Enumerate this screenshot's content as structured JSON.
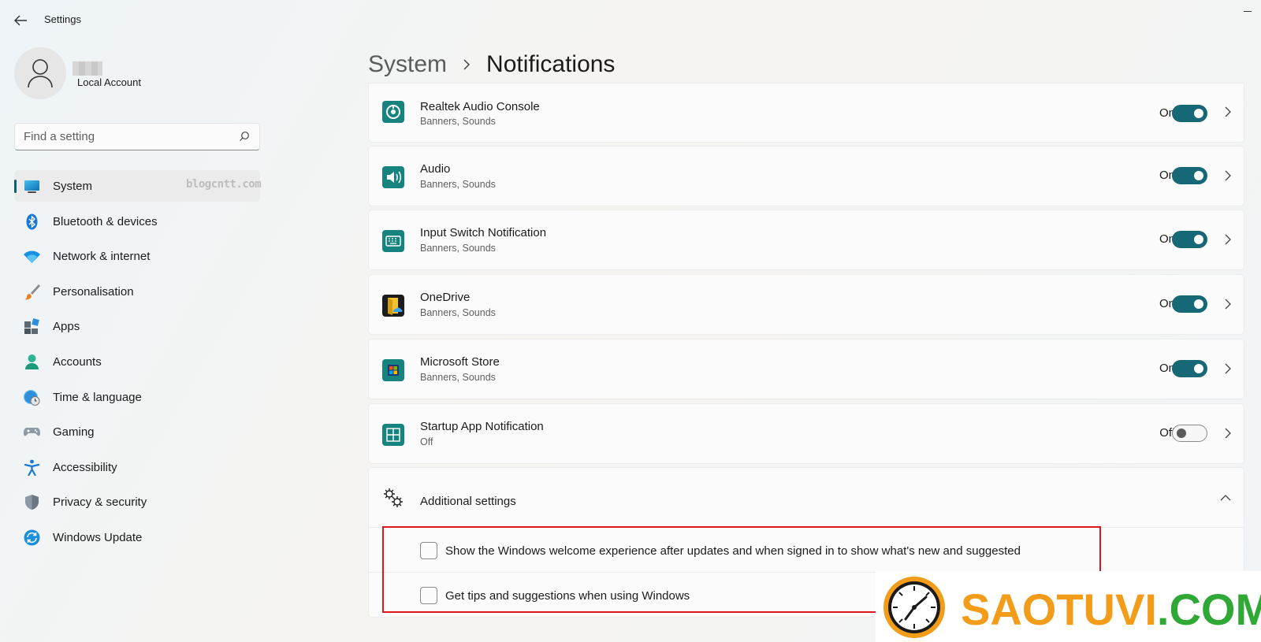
{
  "window": {
    "title": "Settings"
  },
  "profile": {
    "account_type": "Local Account"
  },
  "search": {
    "placeholder": "Find a setting"
  },
  "sidebar": {
    "watermark": "blogcntt.com",
    "items": [
      {
        "label": "System",
        "icon": "monitor-icon",
        "active": true
      },
      {
        "label": "Bluetooth & devices",
        "icon": "bluetooth-icon"
      },
      {
        "label": "Network & internet",
        "icon": "wifi-icon"
      },
      {
        "label": "Personalisation",
        "icon": "brush-icon"
      },
      {
        "label": "Apps",
        "icon": "apps-icon"
      },
      {
        "label": "Accounts",
        "icon": "person-icon"
      },
      {
        "label": "Time & language",
        "icon": "globe-clock-icon"
      },
      {
        "label": "Gaming",
        "icon": "gamepad-icon"
      },
      {
        "label": "Accessibility",
        "icon": "accessibility-icon"
      },
      {
        "label": "Privacy & security",
        "icon": "shield-icon"
      },
      {
        "label": "Windows Update",
        "icon": "sync-icon"
      }
    ]
  },
  "breadcrumb": {
    "parent": "System",
    "current": "Notifications"
  },
  "apps": [
    {
      "name": "Realtek Audio Console",
      "detail": "Banners, Sounds",
      "state": "On",
      "on": true,
      "icon": "realtek-icon"
    },
    {
      "name": "Audio",
      "detail": "Banners, Sounds",
      "state": "On",
      "on": true,
      "icon": "speaker-icon"
    },
    {
      "name": "Input Switch Notification",
      "detail": "Banners, Sounds",
      "state": "On",
      "on": true,
      "icon": "keyboard-icon"
    },
    {
      "name": "OneDrive",
      "detail": "Banners, Sounds",
      "state": "On",
      "on": true,
      "icon": "onedrive-icon"
    },
    {
      "name": "Microsoft Store",
      "detail": "Banners, Sounds",
      "state": "On",
      "on": true,
      "icon": "store-icon"
    },
    {
      "name": "Startup App Notification",
      "detail": "Off",
      "state": "Off",
      "on": false,
      "icon": "startup-icon"
    }
  ],
  "additional": {
    "title": "Additional settings",
    "options": [
      {
        "label": "Show the Windows welcome experience after updates and when signed in to show what's new and suggested",
        "checked": false
      },
      {
        "label": "Get tips and suggestions when using Windows",
        "checked": false
      }
    ]
  },
  "brand": {
    "part1": "SAOTUVI",
    "part2": ".COM"
  },
  "colors": {
    "accent": "#166876",
    "highlight": "#e1161d",
    "brand_orange": "#f39c1a",
    "brand_green": "#2fa836"
  }
}
